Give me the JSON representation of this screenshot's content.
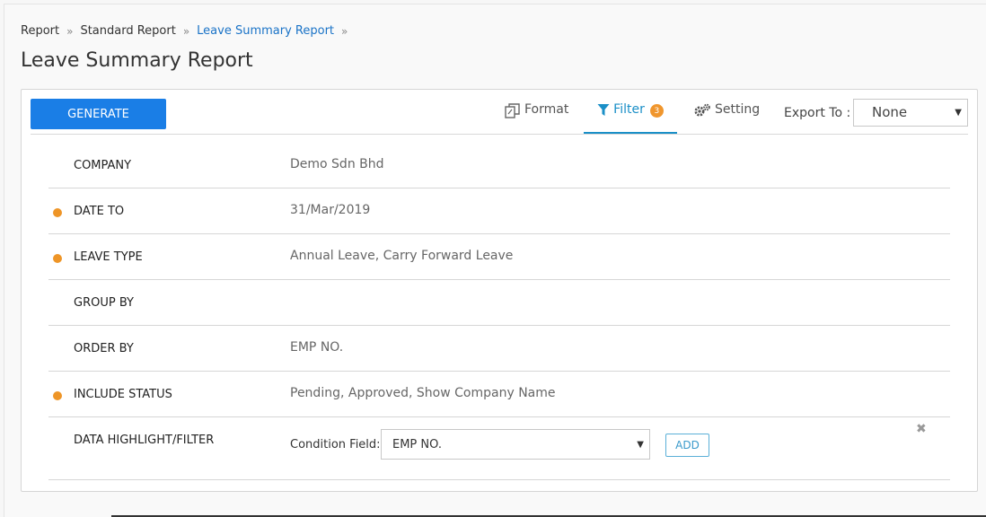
{
  "breadcrumb": [
    "Report",
    "Standard Report",
    "Leave Summary Report"
  ],
  "title": "Leave Summary Report",
  "toolbar": {
    "generate_label": "GENERATE",
    "tabs": {
      "format": "Format",
      "filter": "Filter",
      "filter_badge": "3",
      "setting": "Setting"
    },
    "export_label": "Export To :",
    "export_value": "None"
  },
  "filters": [
    {
      "label": "COMPANY",
      "value": "Demo Sdn Bhd",
      "required": false
    },
    {
      "label": "DATE TO",
      "value": "31/Mar/2019",
      "required": true
    },
    {
      "label": "LEAVE TYPE",
      "value": "Annual Leave, Carry Forward Leave",
      "required": true
    },
    {
      "label": "GROUP BY",
      "value": "",
      "required": false
    },
    {
      "label": "ORDER BY",
      "value": "EMP NO.",
      "required": false
    },
    {
      "label": "INCLUDE STATUS",
      "value": "Pending, Approved, Show Company Name",
      "required": true
    }
  ],
  "highlight": {
    "label": "DATA HIGHLIGHT/FILTER",
    "condition_label": "Condition Field:",
    "condition_value": "EMP NO.",
    "add_label": "ADD",
    "close_glyph": "✖"
  },
  "colors": {
    "primary": "#1a7ee6",
    "accent_tab": "#1a8fc7",
    "required_dot": "#ee9527",
    "badge": "#f0962d"
  }
}
